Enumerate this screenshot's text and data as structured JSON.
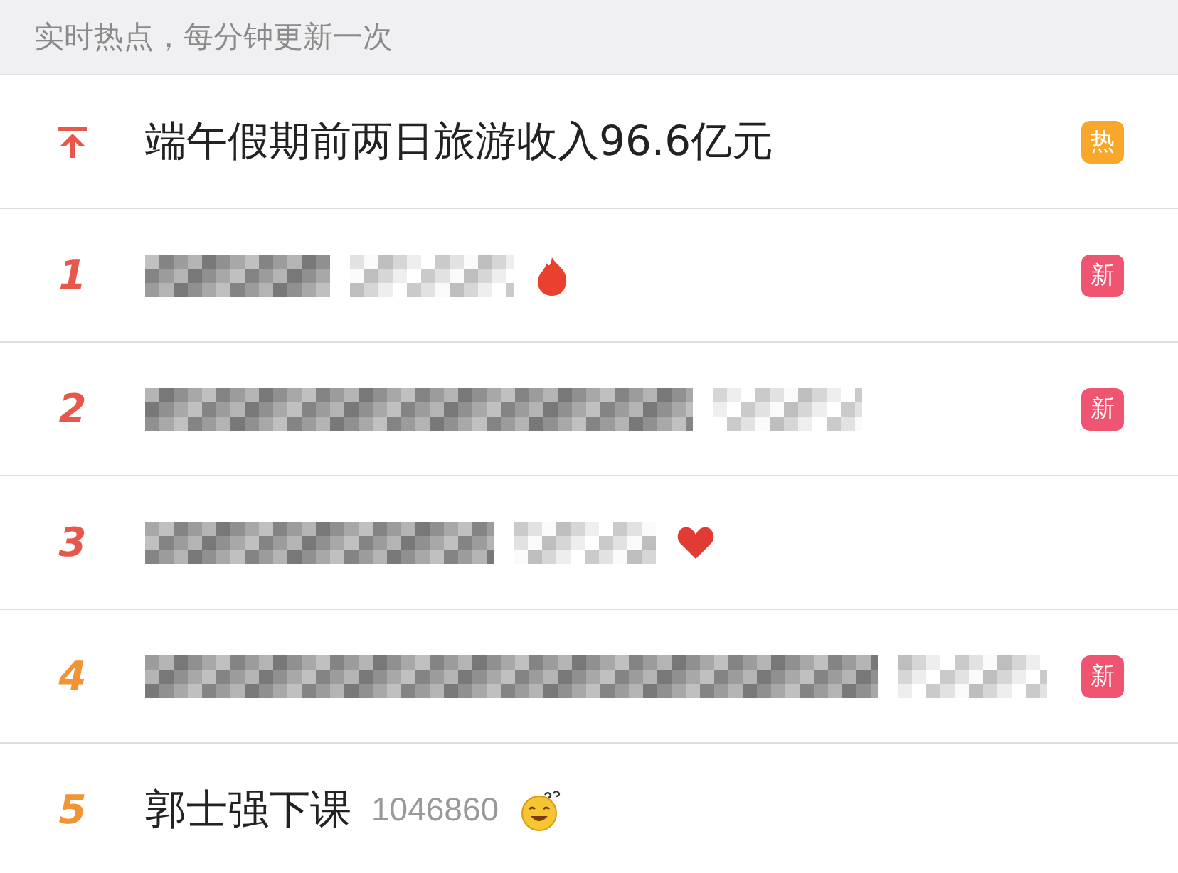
{
  "header": {
    "text": "实时热点，每分钟更新一次"
  },
  "items": [
    {
      "kind": "pinned",
      "title": "端午假期前两日旅游收入96.6亿元",
      "badge": {
        "text": "热",
        "kind": "hot"
      }
    },
    {
      "kind": "ranked",
      "rank": "1",
      "title_redacted": true,
      "count_redacted": true,
      "emoji": {
        "kind": "fire"
      },
      "badge": {
        "text": "新",
        "kind": "new"
      }
    },
    {
      "kind": "ranked",
      "rank": "2",
      "title_redacted": true,
      "count_redacted": true,
      "badge": {
        "text": "新",
        "kind": "new"
      }
    },
    {
      "kind": "ranked",
      "rank": "3",
      "title_redacted": true,
      "count_redacted": true,
      "emoji": {
        "kind": "heart"
      }
    },
    {
      "kind": "ranked",
      "rank": "4",
      "title_redacted": true,
      "count_redacted": true,
      "badge": {
        "text": "新",
        "kind": "new"
      }
    },
    {
      "kind": "ranked",
      "rank": "5",
      "title": "郭士强下课",
      "count": "1046860",
      "emoji": {
        "kind": "grin"
      }
    }
  ]
}
